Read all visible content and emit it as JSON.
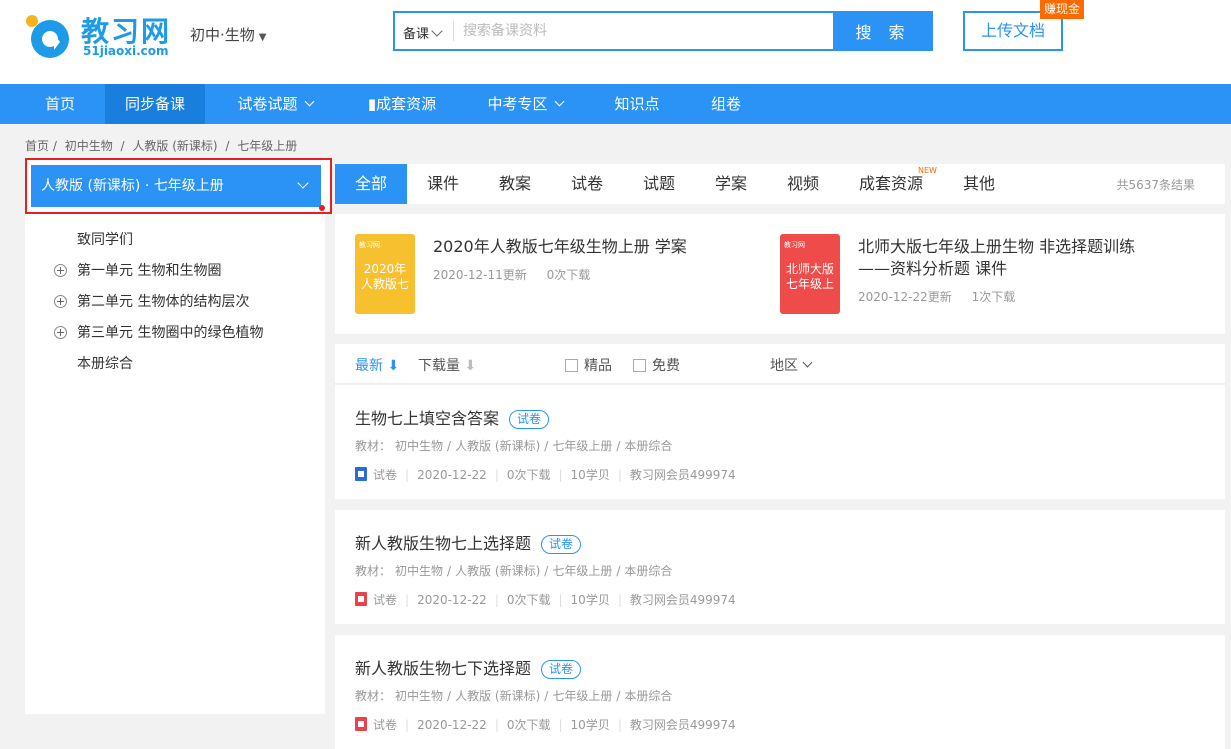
{
  "header": {
    "logo_text": "教习网",
    "logo_sub": "51jiaoxi.com",
    "grade_select": "初中·生物",
    "search": {
      "category": "备课",
      "placeholder": "搜索备课资料",
      "button": "搜 索"
    },
    "upload_button": "上传文档",
    "earn_badge": "赚现金"
  },
  "nav": {
    "items": [
      {
        "label": "首页"
      },
      {
        "label": "同步备课"
      },
      {
        "label": "试卷试题"
      },
      {
        "label": "▮成套资源"
      },
      {
        "label": "中考专区"
      },
      {
        "label": "知识点"
      },
      {
        "label": "组卷"
      }
    ]
  },
  "breadcrumb": [
    "首页 /",
    "初中生物",
    "/",
    "人教版 (新课标)",
    "/",
    "七年级上册"
  ],
  "sidebar": {
    "header": "人教版 (新课标) · 七年级上册",
    "items": [
      {
        "label": "致同学们"
      },
      {
        "label": "第一单元 生物和生物圈"
      },
      {
        "label": "第二单元 生物体的结构层次"
      },
      {
        "label": "第三单元 生物圈中的绿色植物"
      },
      {
        "label": "本册综合"
      }
    ]
  },
  "tabs": {
    "items": [
      {
        "label": "全部"
      },
      {
        "label": "课件"
      },
      {
        "label": "教案"
      },
      {
        "label": "试卷"
      },
      {
        "label": "试题"
      },
      {
        "label": "学案"
      },
      {
        "label": "视频"
      },
      {
        "label": "成套资源"
      },
      {
        "label": "其他"
      }
    ],
    "new_badge": "NEW",
    "result_count": "共5637条结果"
  },
  "featured": [
    {
      "title": "2020年人教版七年级生物上册 学案",
      "cover_top": "教习网",
      "cover_text": "2020年 人教版七",
      "date": "2020-12-11更新",
      "downloads": "0次下载",
      "cover_color": "#f7c02e"
    },
    {
      "title": "北师大版七年级上册生物 非选择题训练——资料分析题 课件",
      "cover_top": "教习网",
      "cover_text": "北师大版 七年级上",
      "date": "2020-12-22更新",
      "downloads": "1次下载",
      "cover_color": "#ef4b4b"
    }
  ],
  "sortbar": {
    "latest": "最新",
    "latest_arrow": "⬇",
    "downloads": "下载量",
    "downloads_arrow": "⬇",
    "premium": "精品",
    "free": "免费",
    "region": "地区"
  },
  "results": [
    {
      "title": "生物七上填空含答案",
      "tag": "试卷",
      "path": [
        "教材：",
        "初中生物",
        "/",
        "人教版 (新课标)",
        "/",
        "七年级上册",
        "/",
        "本册综合"
      ],
      "type": "试卷",
      "file_icon": "word-icon",
      "date": "2020-12-22",
      "downloads": "0次下载",
      "price": "10学贝",
      "uploader": "教习网会员499974"
    },
    {
      "title": "新人教版生物七上选择题",
      "tag": "试卷",
      "path": [
        "教材：",
        "初中生物",
        "/",
        "人教版 (新课标)",
        "/",
        "七年级上册",
        "/",
        "本册综合"
      ],
      "type": "试卷",
      "file_icon": "pdf-icon",
      "date": "2020-12-22",
      "downloads": "0次下载",
      "price": "10学贝",
      "uploader": "教习网会员499974"
    },
    {
      "title": "新人教版生物七下选择题",
      "tag": "试卷",
      "path": [
        "教材：",
        "初中生物",
        "/",
        "人教版 (新课标)",
        "/",
        "七年级上册",
        "/",
        "本册综合"
      ],
      "type": "试卷",
      "file_icon": "pdf-icon",
      "date": "2020-12-22",
      "downloads": "0次下载",
      "price": "10学贝",
      "uploader": "教习网会员499974"
    }
  ]
}
